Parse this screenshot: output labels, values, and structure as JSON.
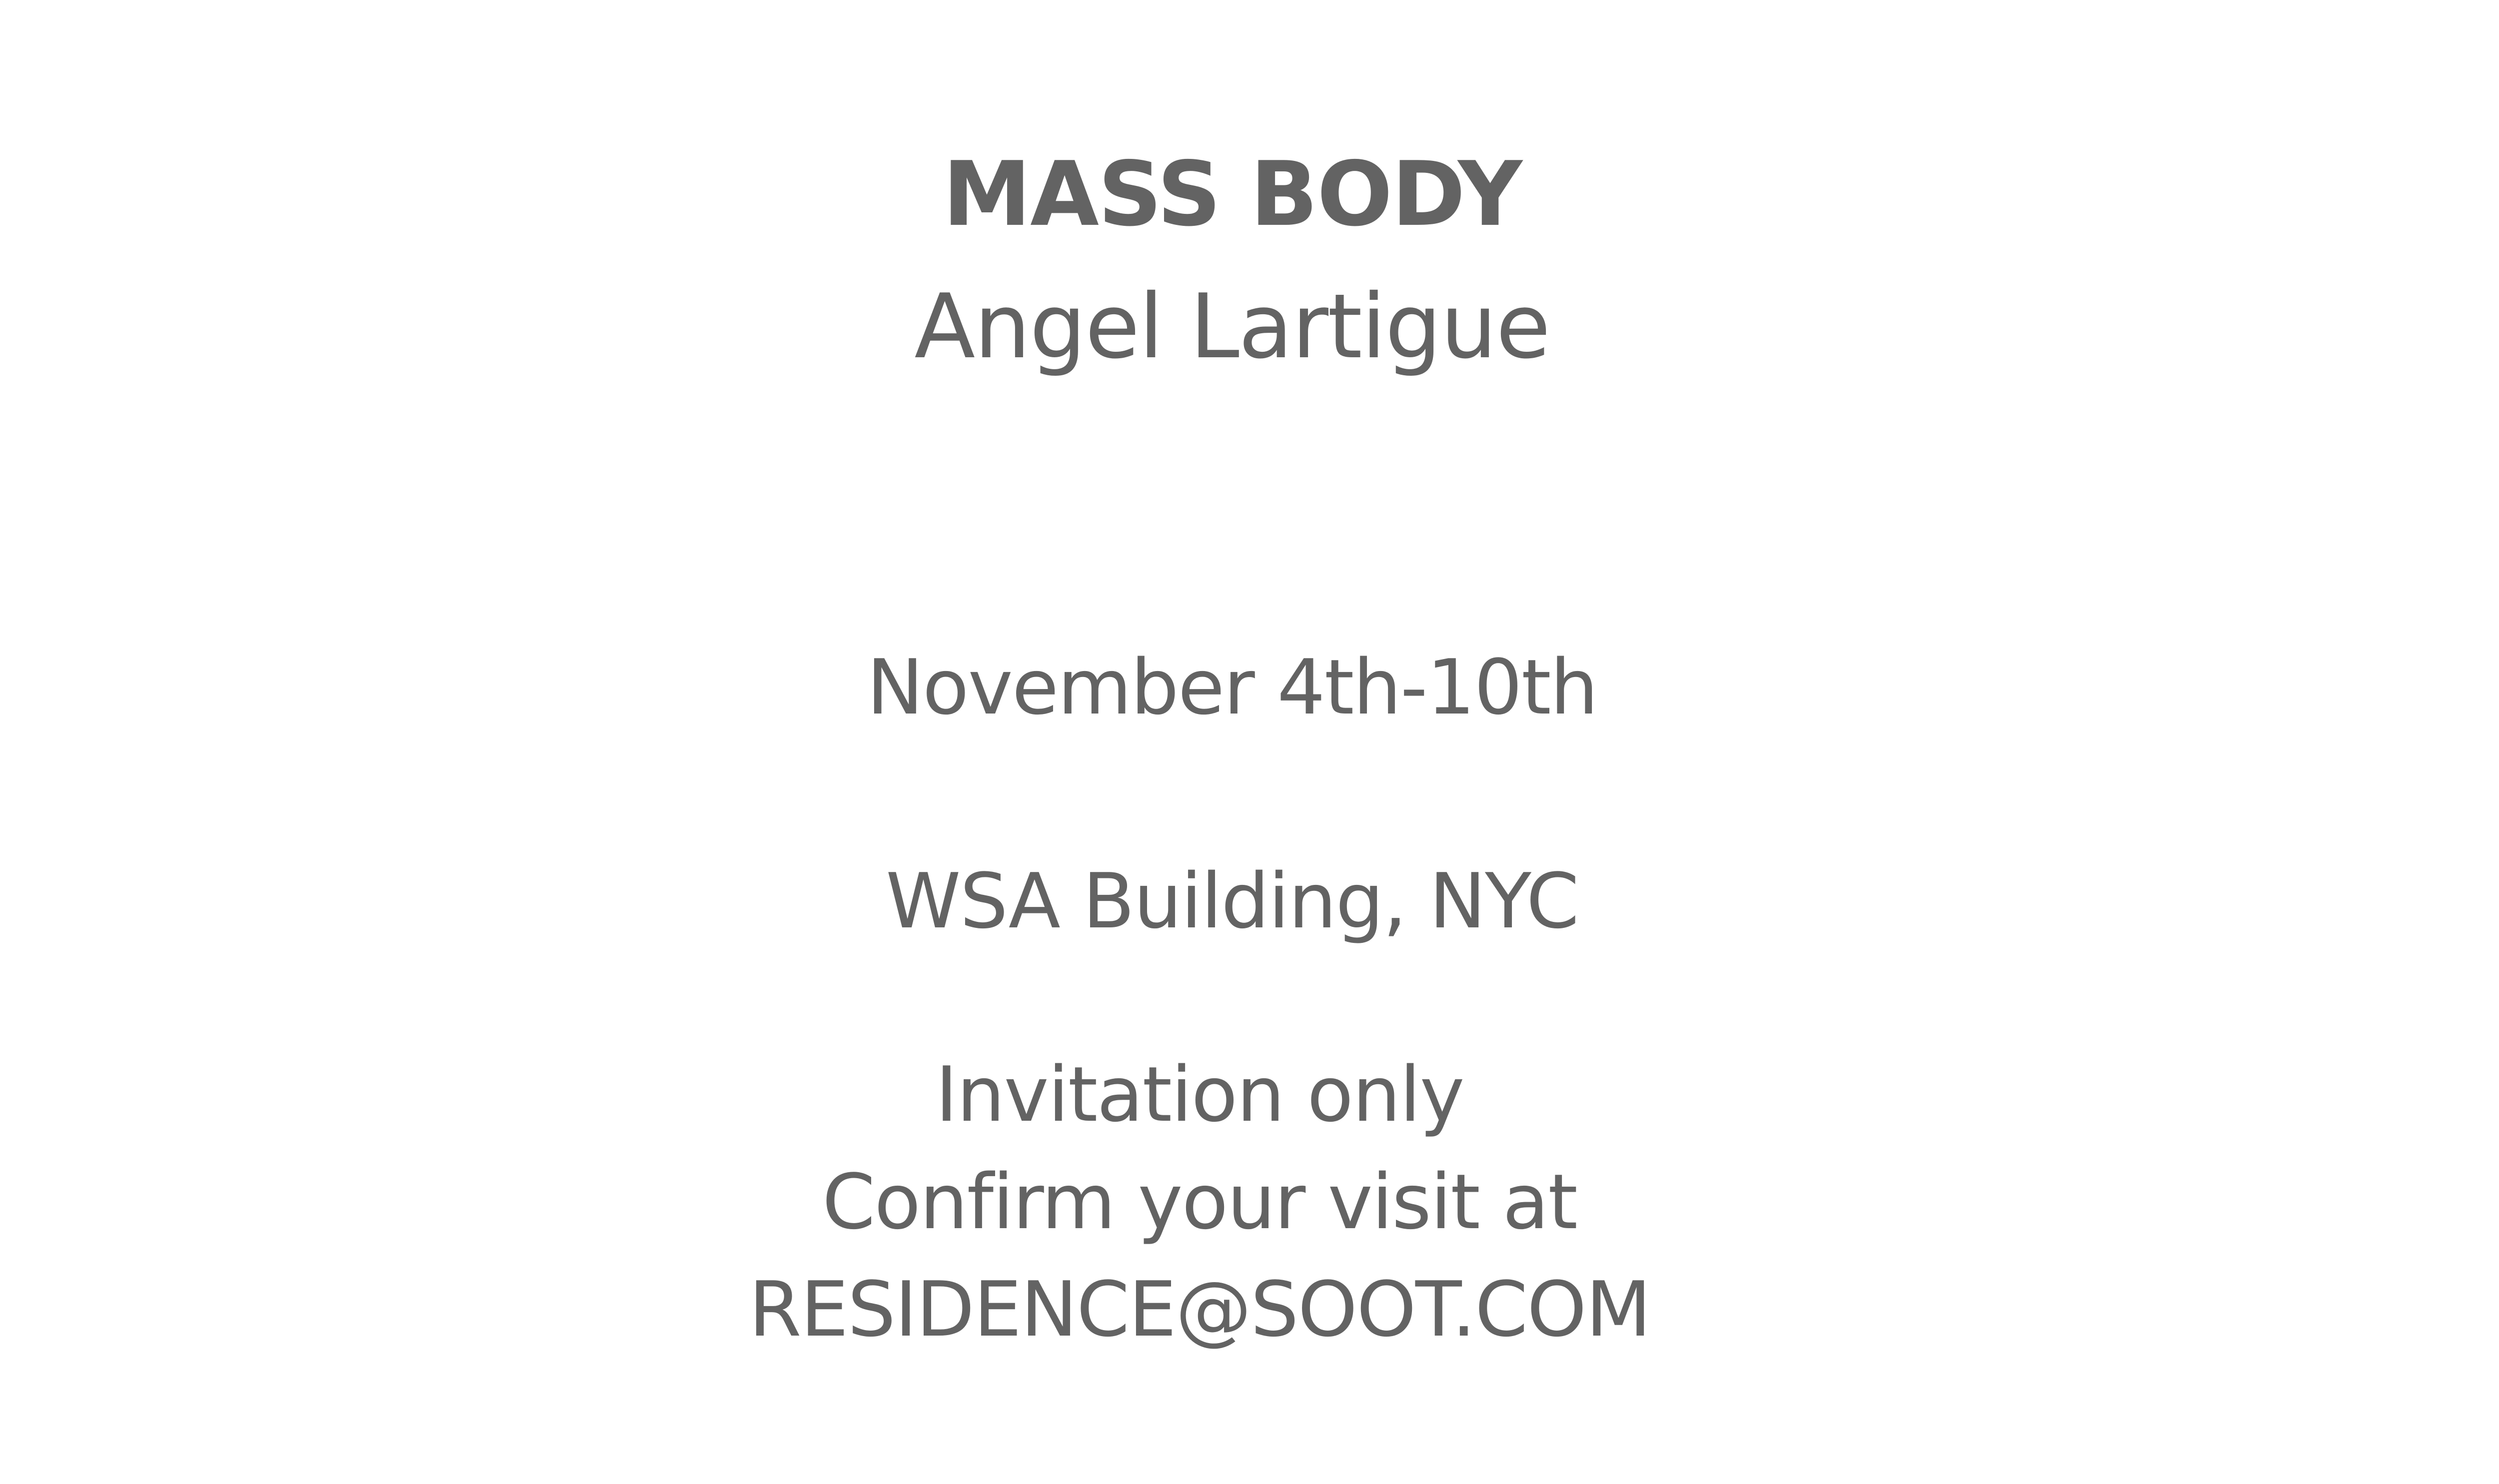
{
  "event": {
    "title": "MASS BODY",
    "artist": "Angel Lartigue",
    "dates": "November 4th-10th",
    "venue": "WSA Building, NYC",
    "access": "Invitation only",
    "confirm": "Confirm your visit at",
    "email": "RESIDENCE@SOOT.COM"
  },
  "colors": {
    "text": "#636363",
    "background": "#ffffff"
  }
}
